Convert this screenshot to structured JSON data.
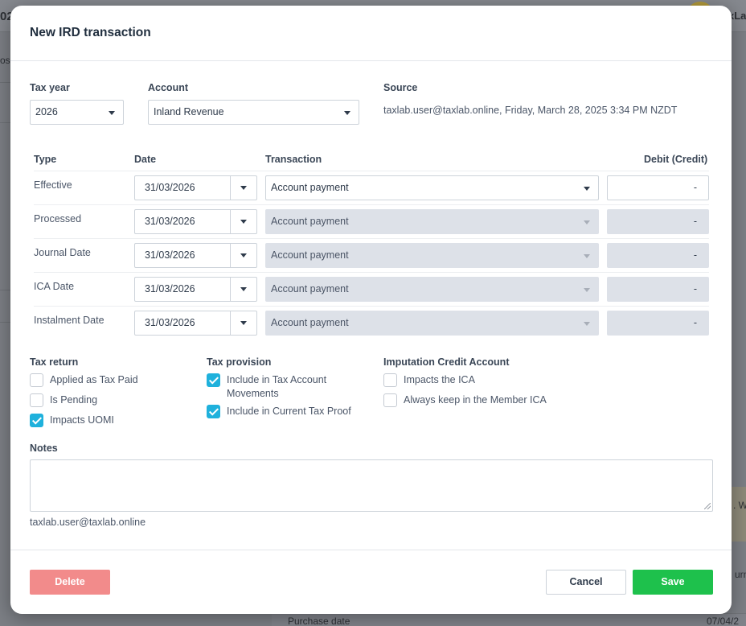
{
  "background": {
    "fragments": [
      "02",
      "xLa",
      "osi",
      ". W",
      "urn",
      "Purchase date",
      "07/04/2"
    ]
  },
  "modal": {
    "title": "New IRD transaction",
    "tax_year": {
      "label": "Tax year",
      "value": "2026"
    },
    "account": {
      "label": "Account",
      "value": "Inland Revenue"
    },
    "source": {
      "label": "Source",
      "value": "taxlab.user@taxlab.online, Friday, March 28, 2025 3:34 PM NZDT"
    },
    "table": {
      "headers": {
        "type": "Type",
        "date": "Date",
        "transaction": "Transaction",
        "debit": "Debit (Credit)"
      },
      "rows": [
        {
          "type": "Effective",
          "date": "31/03/2026",
          "transaction": "Account payment",
          "debit": "-",
          "enabled": true
        },
        {
          "type": "Processed",
          "date": "31/03/2026",
          "transaction": "Account payment",
          "debit": "-",
          "enabled": false
        },
        {
          "type": "Journal Date",
          "date": "31/03/2026",
          "transaction": "Account payment",
          "debit": "-",
          "enabled": false
        },
        {
          "type": "ICA Date",
          "date": "31/03/2026",
          "transaction": "Account payment",
          "debit": "-",
          "enabled": false
        },
        {
          "type": "Instalment Date",
          "date": "31/03/2026",
          "transaction": "Account payment",
          "debit": "-",
          "enabled": false
        }
      ]
    },
    "tax_return": {
      "label": "Tax return",
      "options": [
        {
          "label": "Applied as Tax Paid",
          "checked": false
        },
        {
          "label": "Is Pending",
          "checked": false
        },
        {
          "label": "Impacts UOMI",
          "checked": true
        }
      ]
    },
    "tax_provision": {
      "label": "Tax provision",
      "options": [
        {
          "label": "Include in Tax Account Movements",
          "checked": true
        },
        {
          "label": "Include in Current Tax Proof",
          "checked": true
        }
      ]
    },
    "ica": {
      "label": "Imputation Credit Account",
      "options": [
        {
          "label": "Impacts the ICA",
          "checked": false
        },
        {
          "label": "Always keep in the Member ICA",
          "checked": false
        }
      ]
    },
    "notes": {
      "label": "Notes",
      "value": "",
      "author": "taxlab.user@taxlab.online"
    },
    "buttons": {
      "delete": "Delete",
      "cancel": "Cancel",
      "save": "Save"
    },
    "colors": {
      "checkbox": "#1fb1dc",
      "save": "#1ec14c",
      "delete": "#f28b8b"
    }
  }
}
